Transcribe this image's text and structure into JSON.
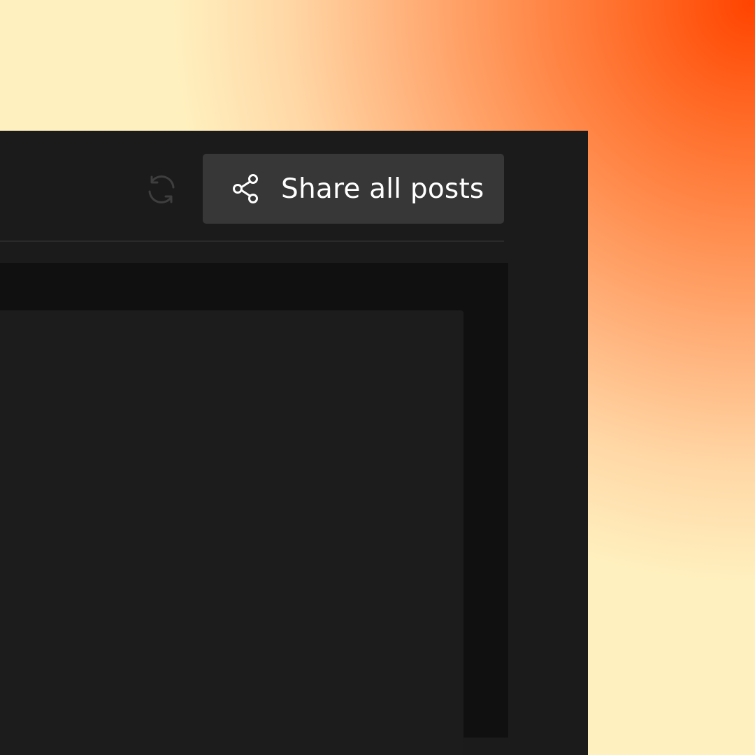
{
  "toolbar": {
    "refresh_icon": "refresh-icon",
    "share_button": {
      "icon": "share-icon",
      "label": "Share all posts"
    }
  },
  "colors": {
    "window_background": "#1b1b1b",
    "button_background": "#373737",
    "content_well": "#101010",
    "content_panel": "#1c1c1c",
    "button_text": "#ffffff",
    "backdrop_hot": "#ff4400",
    "backdrop_light": "#fff0bf"
  }
}
